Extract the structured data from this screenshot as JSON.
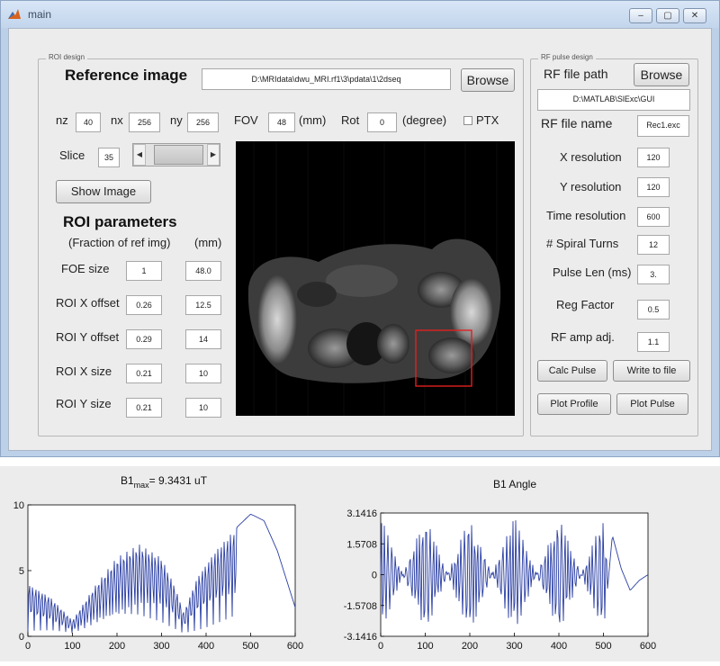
{
  "window": {
    "title": "main"
  },
  "roi": {
    "group_label": "ROI design",
    "reference_label": "Reference image",
    "ref_path": "D:\\MRIdata\\dwu_MRI.rf1\\3\\pdata\\1\\2dseq",
    "browse_label": "Browse",
    "nz_label": "nz",
    "nz_value": "40",
    "nx_label": "nx",
    "nx_value": "256",
    "ny_label": "ny",
    "ny_value": "256",
    "fov_label": "FOV",
    "fov_value": "48",
    "fov_unit": "(mm)",
    "rot_label": "Rot",
    "rot_value": "0",
    "rot_unit": "(degree)",
    "ptx_label": "PTX",
    "slice_label": "Slice",
    "slice_value": "35",
    "show_image_label": "Show Image",
    "params_title": "ROI parameters",
    "fraction_header": "(Fraction of ref img)",
    "mm_header": "(mm)",
    "rows": [
      {
        "label": "FOE size",
        "fraction": "1",
        "mm": "48.0"
      },
      {
        "label": "ROI X offset",
        "fraction": "0.26",
        "mm": "12.5"
      },
      {
        "label": "ROI Y offset",
        "fraction": "0.29",
        "mm": "14"
      },
      {
        "label": "ROI X size",
        "fraction": "0.21",
        "mm": "10"
      },
      {
        "label": "ROI Y size",
        "fraction": "0.21",
        "mm": "10"
      }
    ]
  },
  "rf": {
    "group_label": "RF pulse design",
    "path_label": "RF file path",
    "browse_label": "Browse",
    "path_value": "D:\\MATLAB\\SlExc\\GUI",
    "name_label": "RF file name",
    "name_value": "Rec1.exc",
    "params": [
      {
        "label": "X resolution",
        "value": "120"
      },
      {
        "label": "Y resolution",
        "value": "120"
      },
      {
        "label": "Time resolution",
        "value": "600"
      },
      {
        "label": "# Spiral Turns",
        "value": "12"
      },
      {
        "label": "Pulse Len (ms)",
        "value": "3."
      },
      {
        "label": "Reg Factor",
        "value": "0.5"
      },
      {
        "label": "RF amp adj.",
        "value": "1.1"
      }
    ],
    "calc_pulse_label": "Calc Pulse",
    "write_file_label": "Write to file",
    "plot_profile_label": "Plot Profile",
    "plot_pulse_label": "Plot Pulse"
  },
  "chart_data": [
    {
      "type": "line",
      "title_main": "B1",
      "title_sub": "max",
      "title_rest": "= 9.3431 uT",
      "xlim": [
        0,
        600
      ],
      "ylim": [
        0,
        10
      ],
      "xticks": [
        0,
        100,
        200,
        300,
        400,
        500,
        600
      ],
      "yticks": [
        0,
        5,
        10
      ],
      "color": "#2b3fa3",
      "x": [
        0,
        50,
        100,
        150,
        200,
        250,
        300,
        330,
        350,
        380,
        420,
        460,
        500,
        530,
        560,
        600
      ],
      "y": [
        4.0,
        3.0,
        1.2,
        3.8,
        6.0,
        7.0,
        6.0,
        3.8,
        1.8,
        4.5,
        6.5,
        8.0,
        9.3,
        8.8,
        6.5,
        2.2
      ]
    },
    {
      "type": "line",
      "title_main": "B1 Angle",
      "xlim": [
        0,
        600
      ],
      "ylim": [
        -3.1416,
        3.1416
      ],
      "xticks": [
        0,
        100,
        200,
        300,
        400,
        500,
        600
      ],
      "yticks": [
        "3.1416",
        "1.5708",
        "0",
        "-1.5708",
        "-3.1416"
      ],
      "color": "#2b3fa3",
      "x": [
        0,
        100,
        200,
        300,
        400,
        500,
        520,
        540,
        560,
        580,
        600
      ],
      "y": [
        3.0,
        -3.0,
        3.0,
        -3.0,
        3.0,
        -3.0,
        2.0,
        0.3,
        -0.8,
        -0.3,
        0
      ]
    }
  ]
}
